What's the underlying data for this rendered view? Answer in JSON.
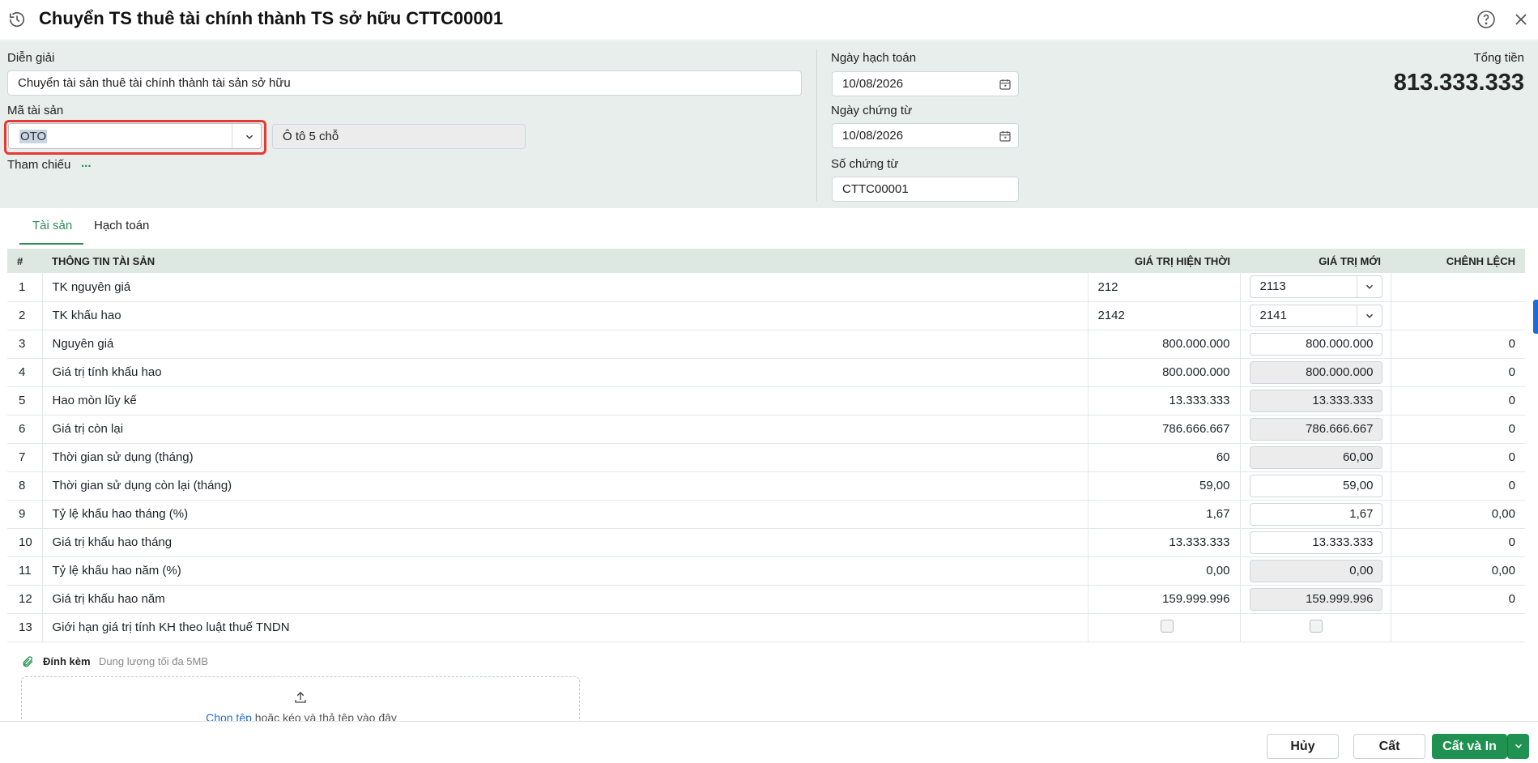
{
  "window": {
    "title": "Chuyển TS thuê tài chính thành TS sở hữu CTTC00001"
  },
  "header": {
    "dien_giai_label": "Diễn giải",
    "dien_giai_value": "Chuyển tài sản thuê tài chính thành tài sản sở hữu",
    "ma_tai_san_label": "Mã tài sản",
    "ma_tai_san_value": "OTO",
    "ten_tai_san_value": "Ô tô 5 chỗ",
    "tham_chieu_label": "Tham chiếu",
    "tham_chieu_more": "...",
    "ngay_hach_toan_label": "Ngày hạch toán",
    "ngay_hach_toan_value": "10/08/2026",
    "ngay_chung_tu_label": "Ngày chứng từ",
    "ngay_chung_tu_value": "10/08/2026",
    "so_chung_tu_label": "Số chứng từ",
    "so_chung_tu_value": "CTTC00001",
    "tong_tien_label": "Tổng tiền",
    "tong_tien_value": "813.333.333"
  },
  "tabs": [
    {
      "label": "Tài sản",
      "active": true
    },
    {
      "label": "Hạch toán",
      "active": false
    }
  ],
  "table": {
    "columns": [
      "#",
      "THÔNG TIN TÀI SẢN",
      "GIÁ TRỊ HIỆN THỜI",
      "GIÁ TRỊ MỚI",
      "CHÊNH LỆCH"
    ],
    "rows": [
      {
        "no": "1",
        "info": "TK nguyên giá",
        "current": "212",
        "new": "2113",
        "diff": "",
        "kind": "select"
      },
      {
        "no": "2",
        "info": "TK khấu hao",
        "current": "2142",
        "new": "2141",
        "diff": "",
        "kind": "select"
      },
      {
        "no": "3",
        "info": "Nguyên giá",
        "current": "800.000.000",
        "new": "800.000.000",
        "diff": "0",
        "kind": "edit"
      },
      {
        "no": "4",
        "info": "Giá trị tính khấu hao",
        "current": "800.000.000",
        "new": "800.000.000",
        "diff": "0",
        "kind": "readonly"
      },
      {
        "no": "5",
        "info": "Hao mòn lũy kế",
        "current": "13.333.333",
        "new": "13.333.333",
        "diff": "0",
        "kind": "readonly"
      },
      {
        "no": "6",
        "info": "Giá trị còn lại",
        "current": "786.666.667",
        "new": "786.666.667",
        "diff": "0",
        "kind": "readonly"
      },
      {
        "no": "7",
        "info": "Thời gian sử dụng (tháng)",
        "current": "60",
        "new": "60,00",
        "diff": "0",
        "kind": "readonly"
      },
      {
        "no": "8",
        "info": "Thời gian sử dụng còn lại (tháng)",
        "current": "59,00",
        "new": "59,00",
        "diff": "0",
        "kind": "edit"
      },
      {
        "no": "9",
        "info": "Tỷ lệ khấu hao tháng (%)",
        "current": "1,67",
        "new": "1,67",
        "diff": "0,00",
        "kind": "edit"
      },
      {
        "no": "10",
        "info": "Giá trị khấu hao tháng",
        "current": "13.333.333",
        "new": "13.333.333",
        "diff": "0",
        "kind": "edit"
      },
      {
        "no": "11",
        "info": "Tỷ lệ khấu hao năm (%)",
        "current": "0,00",
        "new": "0,00",
        "diff": "0,00",
        "kind": "readonly"
      },
      {
        "no": "12",
        "info": "Giá trị khấu hao năm",
        "current": "159.999.996",
        "new": "159.999.996",
        "diff": "0",
        "kind": "readonly"
      },
      {
        "no": "13",
        "info": "Giới hạn giá trị tính KH theo luật thuế TNDN",
        "current": "",
        "new": "",
        "diff": "",
        "kind": "checkbox"
      }
    ]
  },
  "attachments": {
    "label": "Đính kèm",
    "hint": "Dung lượng tối đa 5MB",
    "choose_link": "Chọn tệp",
    "drop_text": "hoặc kéo và thả tệp vào đây"
  },
  "footer": {
    "cancel_label": "Hủy",
    "save_label": "Cất",
    "save_print_label": "Cất và In"
  },
  "colors": {
    "accent": "#1f9151",
    "focus": "#e53935",
    "link": "#2a6dc9"
  }
}
